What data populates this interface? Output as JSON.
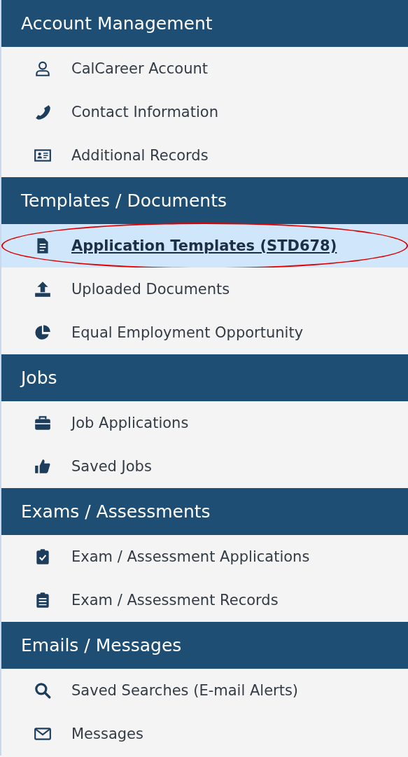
{
  "sections": [
    {
      "title": "Account Management",
      "items": [
        {
          "label": "CalCareer Account",
          "selected": false,
          "circled": false
        },
        {
          "label": "Contact Information",
          "selected": false,
          "circled": false
        },
        {
          "label": "Additional Records",
          "selected": false,
          "circled": false
        }
      ]
    },
    {
      "title": "Templates / Documents",
      "items": [
        {
          "label": "Application Templates (STD678)",
          "selected": true,
          "circled": true
        },
        {
          "label": "Uploaded Documents",
          "selected": false,
          "circled": false
        },
        {
          "label": "Equal Employment Opportunity",
          "selected": false,
          "circled": false
        }
      ]
    },
    {
      "title": "Jobs",
      "items": [
        {
          "label": "Job Applications",
          "selected": false,
          "circled": false
        },
        {
          "label": "Saved Jobs",
          "selected": false,
          "circled": false
        }
      ]
    },
    {
      "title": "Exams / Assessments",
      "items": [
        {
          "label": "Exam / Assessment Applications",
          "selected": false,
          "circled": false
        },
        {
          "label": "Exam / Assessment Records",
          "selected": false,
          "circled": false
        }
      ]
    },
    {
      "title": "Emails / Messages",
      "items": [
        {
          "label": "Saved Searches (E-mail Alerts)",
          "selected": false,
          "circled": false
        },
        {
          "label": "Messages",
          "selected": false,
          "circled": false
        }
      ]
    }
  ]
}
